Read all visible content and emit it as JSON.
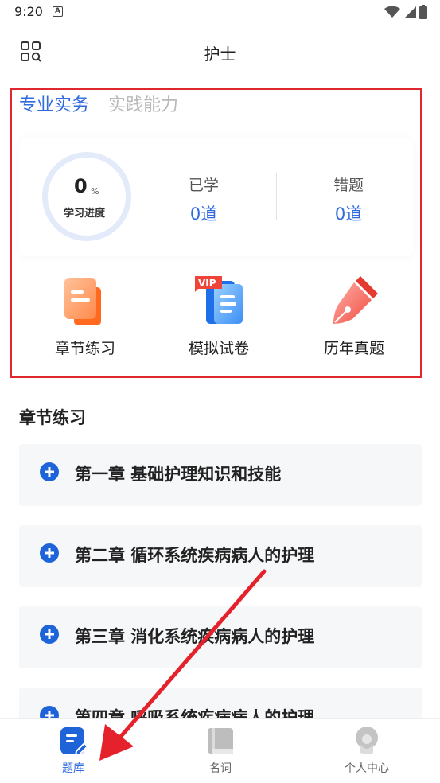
{
  "status_bar": {
    "time": "9:20",
    "notification_letter": "A"
  },
  "header": {
    "title": "护士"
  },
  "subject_tabs": [
    {
      "label": "专业实务",
      "active": true
    },
    {
      "label": "实践能力",
      "active": false
    }
  ],
  "progress": {
    "value": "0",
    "unit": "%",
    "label": "学习进度",
    "fraction": 0
  },
  "stats": [
    {
      "label": "已学",
      "value": "0道"
    },
    {
      "label": "错题",
      "value": "0道"
    }
  ],
  "functions": [
    {
      "label": "章节练习",
      "icon": "chapter-practice-icon"
    },
    {
      "label": "模拟试卷",
      "icon": "mock-exam-vip-icon"
    },
    {
      "label": "历年真题",
      "icon": "past-exams-pen-icon"
    }
  ],
  "section": {
    "title": "章节练习"
  },
  "chapters": [
    "第一章 基础护理知识和技能",
    "第二章 循环系统疾病病人的护理",
    "第三章 消化系统疾病病人的护理",
    "第四章 呼吸系统疾病病人的护理"
  ],
  "bottom_nav": [
    {
      "label": "题库",
      "active": true
    },
    {
      "label": "名词",
      "active": false
    },
    {
      "label": "个人中心",
      "active": false
    }
  ],
  "colors": {
    "accent": "#2f6bdf",
    "highlight_border": "#e0262f",
    "annotation_arrow": "#e5222b"
  }
}
